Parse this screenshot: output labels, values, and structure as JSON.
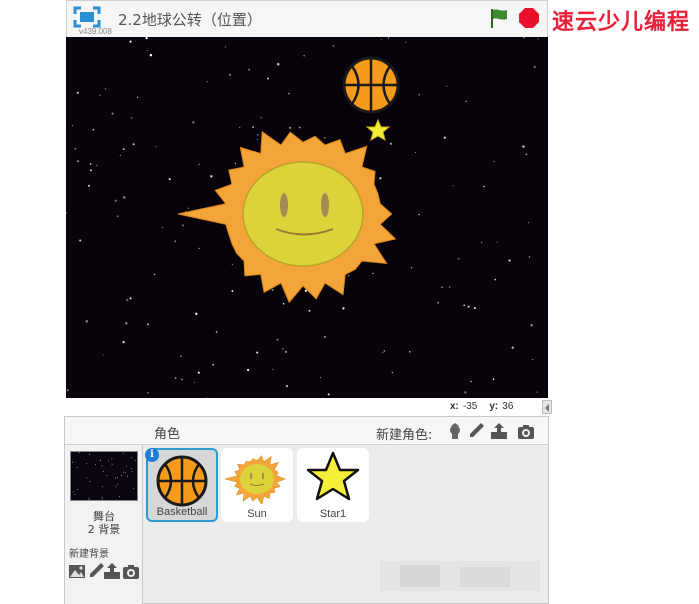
{
  "header": {
    "version": "v439.008",
    "project_title": "2.2地球公转（位置）",
    "brand_text": "速云少儿编程"
  },
  "stage": {
    "coords": {
      "x_label": "x:",
      "x_value": "-35",
      "y_label": "y:",
      "y_value": "36"
    }
  },
  "sprites_panel": {
    "title": "角色",
    "new_sprite_label": "新建角色:",
    "sprites": [
      {
        "name": "Basketball",
        "selected": true
      },
      {
        "name": "Sun",
        "selected": false
      },
      {
        "name": "Star1",
        "selected": false
      }
    ]
  },
  "stage_panel": {
    "name": "舞台",
    "backdrop_count": "2 背景",
    "new_backdrop_label": "新建背景"
  },
  "colors": {
    "accent": "#2a9bd5",
    "stop": "#e8102a",
    "flag": "#3f8a2a",
    "stage_bg": "#08030a",
    "brand": "#e8203a"
  },
  "icons": {
    "fullscreen": "fullscreen-icon",
    "flag": "green-flag-icon",
    "stop": "stop-icon",
    "sprite_tools": [
      "choose-sprite-icon",
      "paint-icon",
      "upload-icon",
      "camera-icon"
    ],
    "backdrop_tools": [
      "choose-backdrop-icon",
      "paint-icon",
      "upload-icon",
      "camera-icon"
    ],
    "info": "info-icon"
  }
}
